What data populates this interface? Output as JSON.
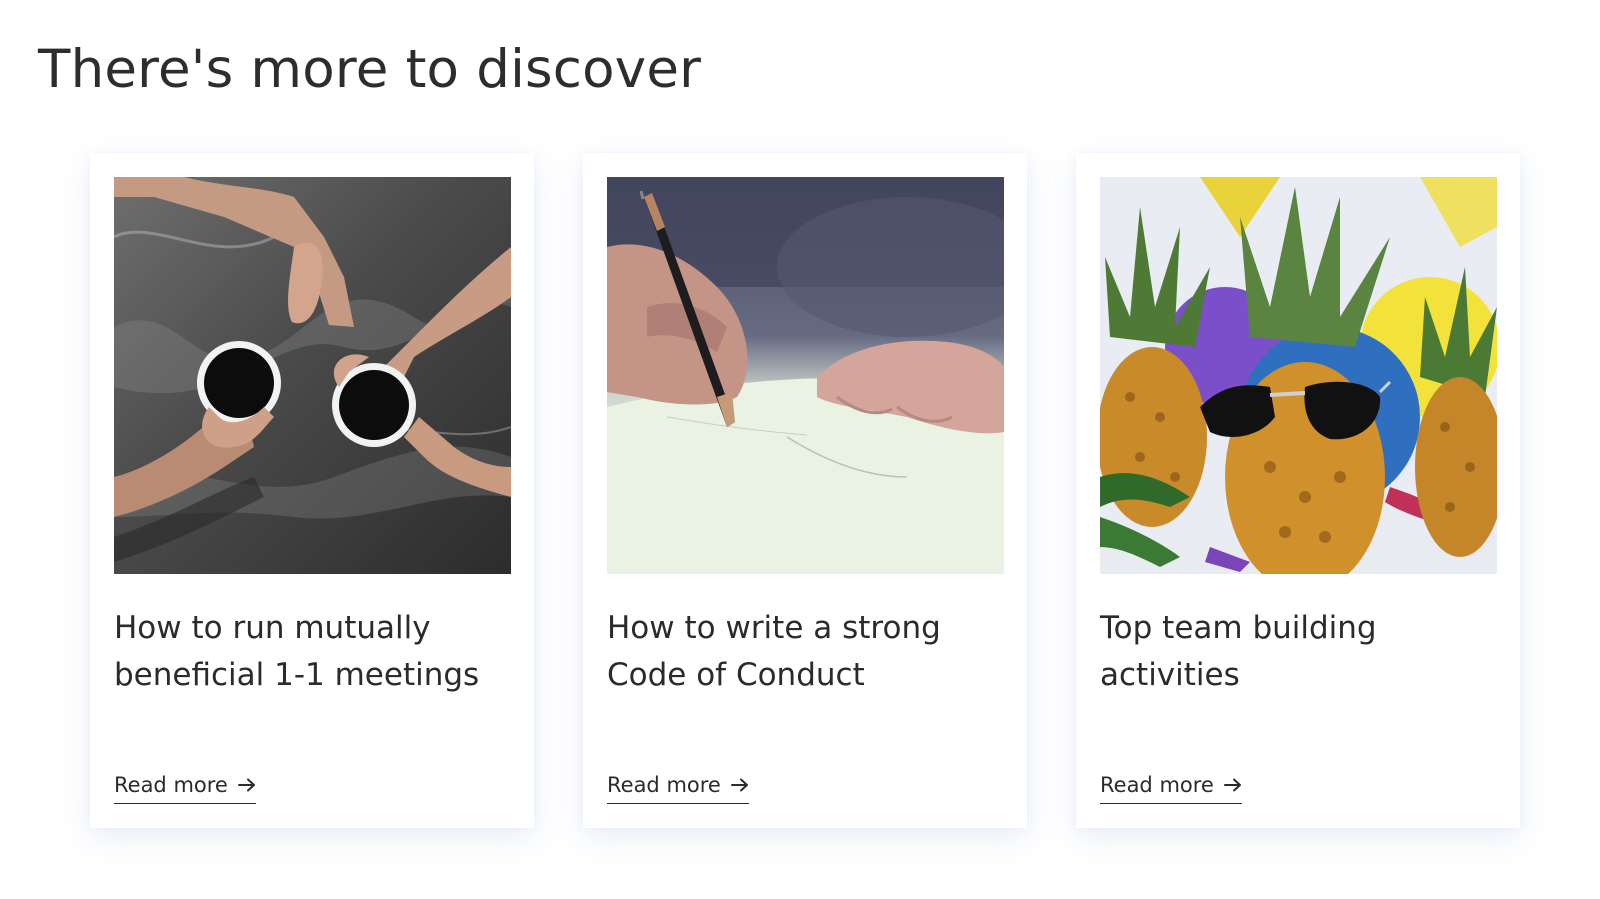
{
  "section": {
    "title": "There's more to discover"
  },
  "cards": [
    {
      "image": "coffee-cups-photo",
      "title": "How to run mutually beneficial 1-1 meetings",
      "link_label": "Read more",
      "link_icon": "arrow-right-icon"
    },
    {
      "image": "pen-writing-photo",
      "title": "How to write a strong Code of Conduct",
      "link_label": "Read more",
      "link_icon": "arrow-right-icon"
    },
    {
      "image": "pineapples-sunglasses-photo",
      "title": "Top team building activities",
      "link_label": "Read more",
      "link_icon": "arrow-right-icon"
    }
  ],
  "colors": {
    "text": "#2b2b2b",
    "background": "#ffffff",
    "card_shadow": "#789ad2"
  }
}
